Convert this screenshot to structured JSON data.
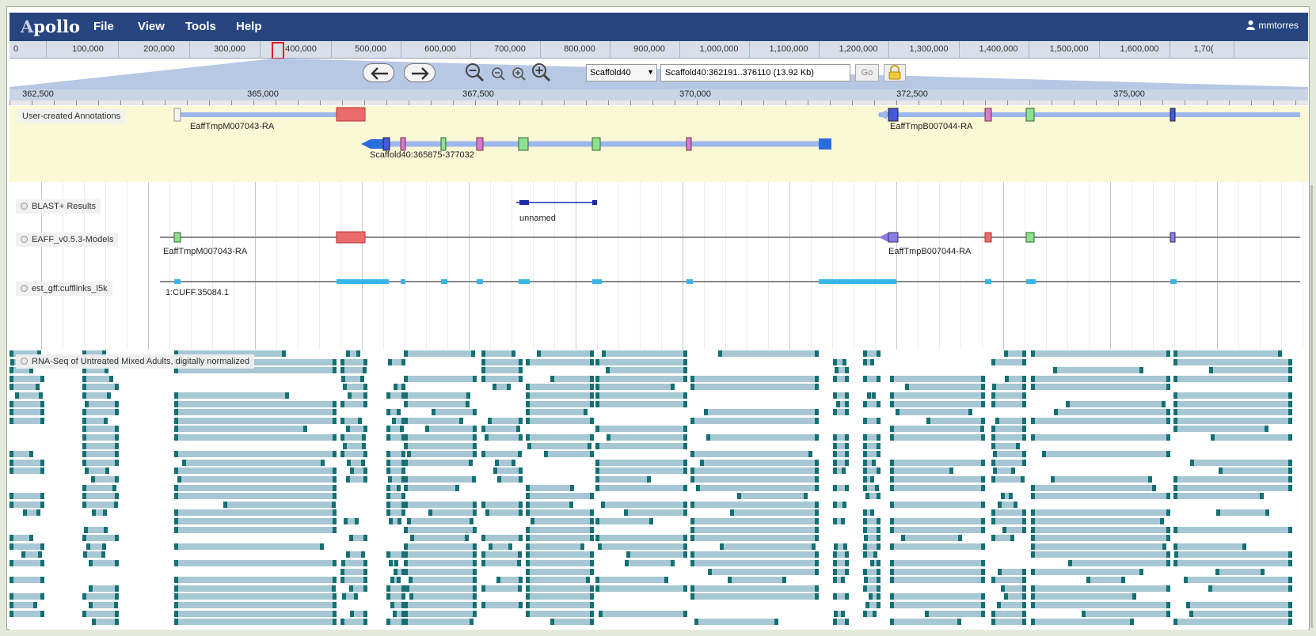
{
  "app": {
    "logo_letter": "A",
    "logo_rest": "pollo"
  },
  "menu": [
    "File",
    "View",
    "Tools",
    "Help"
  ],
  "user": {
    "name": "mmtorres"
  },
  "overview_ticks": [
    "0",
    "100,000",
    "200,000",
    "300,000",
    "400,000",
    "500,000",
    "600,000",
    "700,000",
    "800,000",
    "900,000",
    "1,000,000",
    "1,100,000",
    "1,200,000",
    "1,300,000",
    "1,400,000",
    "1,500,000",
    "1,600,000",
    "1,70("
  ],
  "toolbar": {
    "scaffold_select": "Scaffold40",
    "locus": "Scaffold40:362191..376110 (13.92 Kb)",
    "go_label": "Go"
  },
  "detail_ticks": [
    "362,500",
    "365,000",
    "367,500",
    "370,000",
    "372,500",
    "375,000"
  ],
  "user_annotations": {
    "label": "User-created Annotations",
    "features": [
      "EaffTmpM007043-RA",
      "EaffTmpB007044-RA",
      "Scaffold40:365875-377032"
    ]
  },
  "tracks": [
    {
      "label": "BLAST+ Results",
      "features": [
        "unnamed"
      ]
    },
    {
      "label": "EAFF_v0.5.3-Models",
      "features": [
        "EaffTmpM007043-RA",
        "EaffTmpB007044-RA"
      ]
    },
    {
      "label": "est_gff:cufflinks_l5k",
      "features": [
        "1:CUFF.35084.1"
      ]
    },
    {
      "label": "RNA-Seq of Untreated Mixed Adults, digitally normalized",
      "features": []
    }
  ],
  "colors": {
    "menubar": "#26457f",
    "annotation_bg": "#fbf8d6",
    "exon_red": "#ea6b6b",
    "exon_green": "#8ee08e",
    "exon_magenta": "#d77ad2",
    "exon_blue": "#4458d8",
    "intron": "#9bb7ee",
    "cufflinks": "#38b6e8",
    "read_body": "#a6c7d3",
    "read_end": "#157074"
  },
  "icons": [
    "user-icon",
    "arrow-left-icon",
    "arrow-right-icon",
    "zoom-out-large-icon",
    "zoom-out-icon",
    "zoom-in-icon",
    "zoom-in-large-icon",
    "dropdown-caret-icon",
    "lock-icon"
  ]
}
